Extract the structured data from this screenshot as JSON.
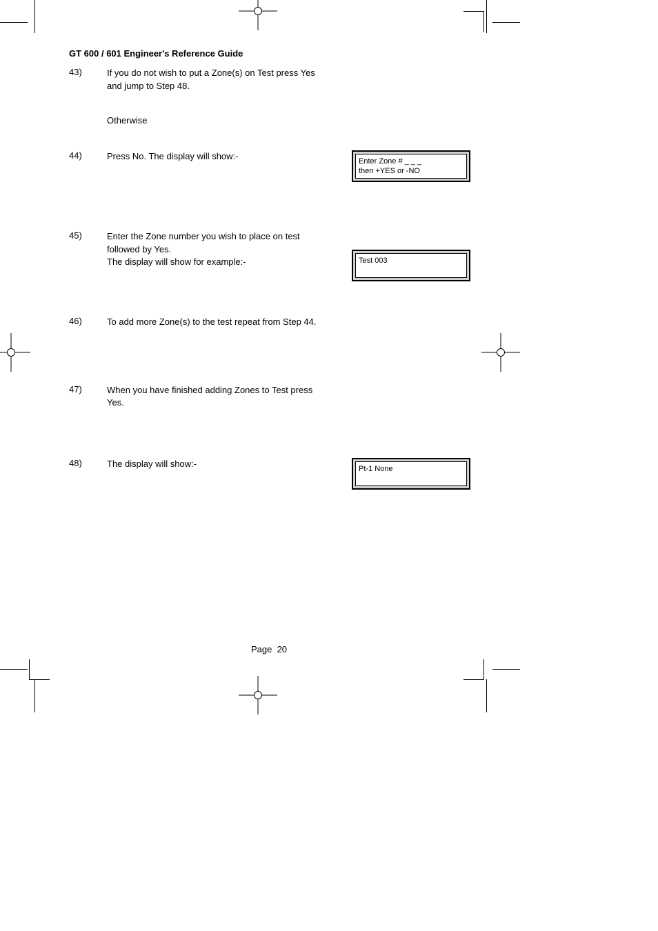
{
  "header": {
    "title": "GT 600 / 601 Engineer's Reference Guide"
  },
  "steps": [
    {
      "num": "43)",
      "text": "If you do not wish to put a Zone(s) on Test press Yes and jump to Step 48.",
      "display": null
    },
    {
      "num": "44)",
      "text": "Press No. The display will show:-",
      "display": {
        "line1": "Enter Zone # _ _ _",
        "line2": "then +YES or -NO"
      }
    },
    {
      "num": "45)",
      "text": "Enter the Zone number you wish to place on test followed by Yes.\nThe display will show for example:-",
      "display": {
        "line1": "Test 003",
        "line2": ""
      }
    },
    {
      "num": "46)",
      "text": "To add more Zone(s) to the test repeat from Step 44.",
      "display": null
    },
    {
      "num": "47)",
      "text": "When you have finished adding Zones to Test press Yes.",
      "display": null
    },
    {
      "num": "48)",
      "text": "The display will show:-",
      "display": {
        "line1": "Pt-1 None",
        "line2": ""
      }
    }
  ],
  "otherwise": "Otherwise",
  "footer": {
    "page_label": "Page",
    "page_number": "20"
  }
}
